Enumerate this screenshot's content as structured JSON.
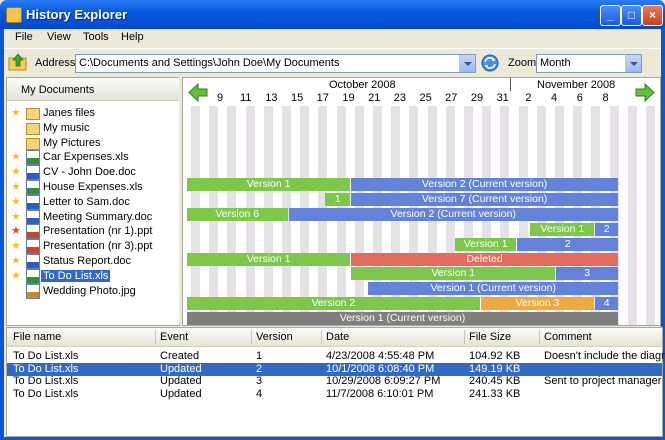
{
  "window": {
    "title": "History Explorer"
  },
  "menu": [
    "File",
    "View",
    "Tools",
    "Help"
  ],
  "toolbar": {
    "address_label": "Address",
    "address_value": "C:\\Documents and Settings\\John Doe\\My Documents",
    "zoom_label": "Zoom",
    "zoom_value": "Month"
  },
  "tree": {
    "header": "My Documents",
    "items": [
      {
        "name": "Janes files",
        "star": "gold",
        "icon": "folder-icon"
      },
      {
        "name": "My music",
        "star": "none",
        "icon": "folder-icon"
      },
      {
        "name": "My Pictures",
        "star": "none",
        "icon": "folder-icon"
      },
      {
        "name": "Car Expenses.xls",
        "star": "gold",
        "icon": "xls-icon"
      },
      {
        "name": "CV - John Doe.doc",
        "star": "gold",
        "icon": "doc-icon"
      },
      {
        "name": "House Expenses.xls",
        "star": "gold",
        "icon": "xls-icon"
      },
      {
        "name": "Letter to Sam.doc",
        "star": "gold",
        "icon": "doc-icon"
      },
      {
        "name": "Meeting Summary.doc",
        "star": "gold",
        "icon": "doc-icon"
      },
      {
        "name": "Presentation (nr 1).ppt",
        "star": "red",
        "icon": "ppt-icon"
      },
      {
        "name": "Presentation (nr 3).ppt",
        "star": "gold",
        "icon": "ppt-icon"
      },
      {
        "name": "Status Report.doc",
        "star": "gold",
        "icon": "doc-icon"
      },
      {
        "name": "To Do List.xls",
        "star": "gold",
        "icon": "xls-icon",
        "selected": true
      },
      {
        "name": "Wedding Photo.jpg",
        "star": "none",
        "icon": "jpg-icon"
      }
    ]
  },
  "timeline": {
    "months": [
      "October 2008",
      "November 2008"
    ],
    "days": [
      "9",
      "11",
      "13",
      "15",
      "17",
      "19",
      "21",
      "23",
      "25",
      "27",
      "29",
      "31",
      "2",
      "4",
      "6",
      "8"
    ],
    "colors": {
      "green": "#7dc84a",
      "blue": "#6283d9",
      "red": "#e46b5e",
      "orange": "#f0a940",
      "gray": "#7f7f7f"
    },
    "rows": [
      {
        "bars": [
          {
            "label": "Version 1",
            "color": "green",
            "span": [
              0,
              0.38
            ]
          },
          {
            "label": "Version 2 (Current version)",
            "color": "blue",
            "span": [
              0.38,
              1
            ]
          }
        ]
      },
      {
        "bars": [
          {
            "label": "1",
            "color": "green",
            "span": [
              0.32,
              0.38
            ]
          },
          {
            "label": "Version 7 (Current version)",
            "color": "blue",
            "span": [
              0.38,
              1
            ]
          }
        ]
      },
      {
        "bars": [
          {
            "label": "Version 6",
            "color": "green",
            "span": [
              0,
              0.235
            ]
          },
          {
            "label": "Version 2 (Current version)",
            "color": "blue",
            "span": [
              0.235,
              1
            ]
          }
        ]
      },
      {
        "bars": [
          {
            "label": "Version 1",
            "color": "green",
            "span": [
              0.795,
              0.945
            ]
          },
          {
            "label": "2",
            "color": "blue",
            "span": [
              0.945,
              1
            ]
          }
        ]
      },
      {
        "bars": [
          {
            "label": "Version 1",
            "color": "green",
            "span": [
              0.62,
              0.765
            ]
          },
          {
            "label": "2",
            "color": "blue",
            "span": [
              0.765,
              1
            ]
          }
        ]
      },
      {
        "bars": [
          {
            "label": "Version 1",
            "color": "green",
            "span": [
              0,
              0.38
            ]
          },
          {
            "label": "Deleted",
            "color": "red",
            "span": [
              0.38,
              1
            ]
          }
        ]
      },
      {
        "bars": [
          {
            "label": "Version 1",
            "color": "green",
            "span": [
              0.38,
              0.855
            ]
          },
          {
            "label": "3",
            "color": "blue",
            "span": [
              0.855,
              1
            ]
          }
        ]
      },
      {
        "bars": [
          {
            "label": "Version 1 (Current version)",
            "color": "blue",
            "span": [
              0.42,
              1
            ]
          }
        ]
      },
      {
        "bars": [
          {
            "label": "Version 2",
            "color": "green",
            "span": [
              0,
              0.68
            ]
          },
          {
            "label": "Version 3",
            "color": "orange",
            "span": [
              0.68,
              0.945
            ]
          },
          {
            "label": "4",
            "color": "blue",
            "span": [
              0.945,
              1
            ]
          }
        ]
      },
      {
        "bars": [
          {
            "label": "Version 1 (Current version)",
            "color": "gray",
            "span": [
              0,
              1
            ]
          }
        ]
      }
    ]
  },
  "grid": {
    "columns": [
      "File name",
      "Event",
      "Version",
      "Date",
      "File Size",
      "Comment"
    ],
    "rows": [
      [
        "To Do List.xls",
        "Created",
        "1",
        "4/23/2008 4:55:48 PM",
        "104.92 KB",
        "Doesn't include the diagram"
      ],
      [
        "To Do List.xls",
        "Updated",
        "2",
        "10/1/2008 6:08:40 PM",
        "149.19 KB",
        ""
      ],
      [
        "To Do List.xls",
        "Updated",
        "3",
        "10/29/2008 6:09:27 PM",
        "240.45 KB",
        "Sent to project manager"
      ],
      [
        "To Do List.xls",
        "Updated",
        "4",
        "11/7/2008 6:10:01 PM",
        "241.33 KB",
        ""
      ]
    ],
    "selected_row": 1
  }
}
